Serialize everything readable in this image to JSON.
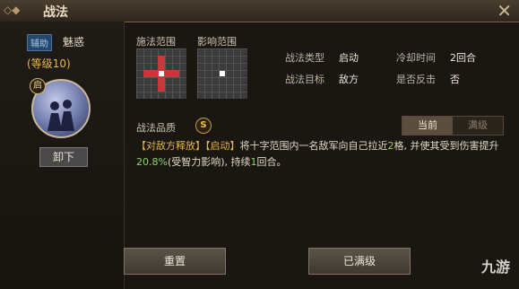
{
  "window": {
    "title": "战法",
    "close_glyph": "✕"
  },
  "left": {
    "tag": "辅助",
    "skill_name": "魅惑",
    "level": "(等级10)",
    "avatar_badge": "启",
    "unequip_label": "卸下"
  },
  "ranges": {
    "cast_label": "施法范围",
    "effect_label": "影响范围"
  },
  "props": {
    "type_label": "战法类型",
    "type_value": "启动",
    "cooldown_label": "冷却时间",
    "cooldown_value": "2回合",
    "target_label": "战法目标",
    "target_value": "敌方",
    "counter_label": "是否反击",
    "counter_value": "否"
  },
  "quality": {
    "label": "战法品质",
    "grade": "S"
  },
  "toggle": {
    "current": "当前",
    "max": "满级"
  },
  "description": {
    "p1": "【对敌方释放】",
    "p2": "【启动】",
    "p3": "将十字范围内一名敌军向自己拉近",
    "p4": "2",
    "p5": "格, 并使其受到伤害提升",
    "p6": "20.8%",
    "p7": "(受智力影响), 持续",
    "p8": "1",
    "p9": "回合。"
  },
  "buttons": {
    "reset": "重置",
    "maxed": "已满级"
  },
  "watermark": "九游",
  "colors": {
    "accent_gold": "#e7b742",
    "range_red": "#c83a3a",
    "value_green": "#8fd36a"
  }
}
